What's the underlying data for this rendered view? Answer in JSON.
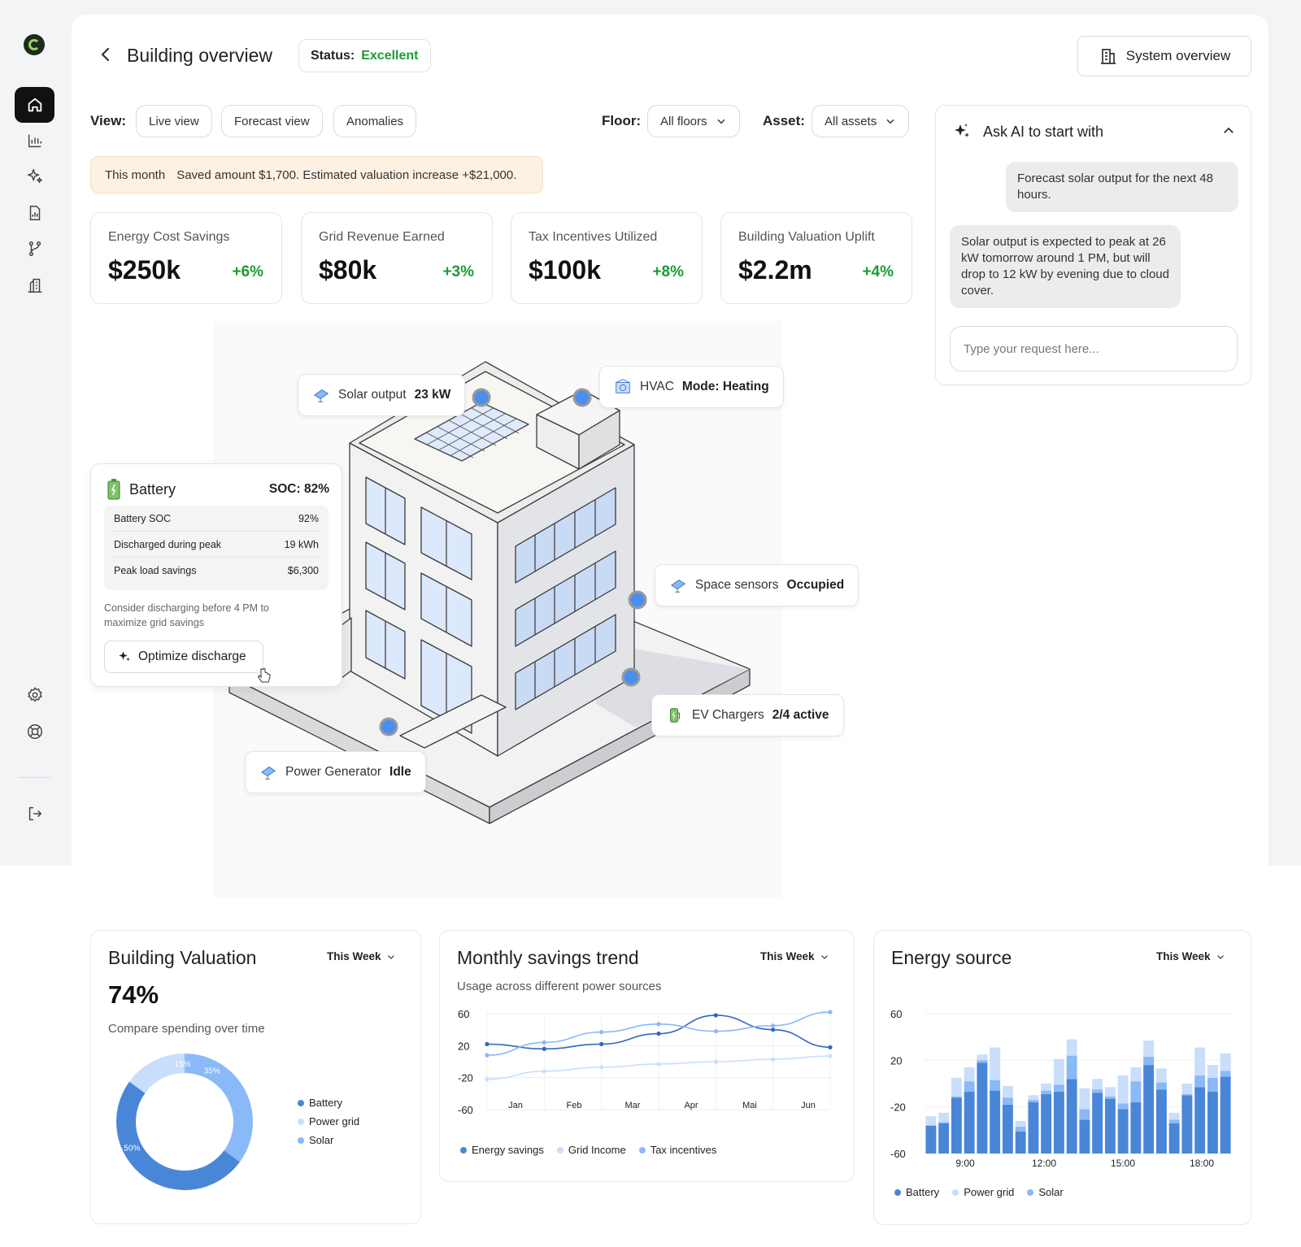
{
  "nav": {
    "items": [
      "home",
      "analytics",
      "ai",
      "reports",
      "flows",
      "buildings"
    ],
    "bottom": [
      "settings",
      "help",
      "logout"
    ]
  },
  "header": {
    "title": "Building overview",
    "status_label": "Status:",
    "status_value": "Excellent",
    "system_button": "System overview"
  },
  "filters": {
    "view_label": "View:",
    "views": [
      "Live view",
      "Forecast view",
      "Anomalies"
    ],
    "floor_label": "Floor:",
    "floor_value": "All floors",
    "asset_label": "Asset:",
    "asset_value": "All assets"
  },
  "notice": {
    "period": "This month",
    "text": "Saved amount $1,700. Estimated valuation increase +$21,000."
  },
  "kpis": [
    {
      "label": "Energy Cost Savings",
      "value": "$250k",
      "change": "+6%"
    },
    {
      "label": "Grid Revenue Earned",
      "value": "$80k",
      "change": "+3%"
    },
    {
      "label": "Tax Incentives Utilized",
      "value": "$100k",
      "change": "+8%"
    },
    {
      "label": "Building Valuation Uplift",
      "value": "$2.2m",
      "change": "+4%"
    }
  ],
  "ai": {
    "title": "Ask AI to start with",
    "user_message": "Forecast solar output for the next 48 hours.",
    "ai_message": "Solar output is expected to peak at 26 kW tomorrow around 1 PM, but will drop to 12 kW by evening due to cloud cover.",
    "input_placeholder": "Type your request here..."
  },
  "tags": {
    "solar": {
      "label": "Solar output",
      "value": "23 kW"
    },
    "hvac": {
      "label": "HVAC",
      "value": "Mode: Heating"
    },
    "space": {
      "label": "Space sensors",
      "value": "Occupied"
    },
    "ev": {
      "label": "EV Chargers",
      "value": "2/4 active"
    },
    "generator": {
      "label": "Power Generator",
      "value": "Idle"
    }
  },
  "battery": {
    "title": "Battery",
    "soc": "SOC: 82%",
    "rows": [
      {
        "label": "Battery SOC",
        "value": "92%"
      },
      {
        "label": "Discharged during peak",
        "value": "19 kWh"
      },
      {
        "label": "Peak load savings",
        "value": "$6,300"
      }
    ],
    "note": "Consider discharging before 4 PM to maximize grid savings",
    "button": "Optimize discharge"
  },
  "colors": {
    "battery": "#4a86d8",
    "power_grid": "#c9defb",
    "solar": "#8ab9f7",
    "positive": "#1a9c35"
  },
  "valuation": {
    "title": "Building Valuation",
    "period": "This Week",
    "value": "74%",
    "subtitle": "Compare spending over time"
  },
  "savings": {
    "title": "Monthly savings trend",
    "period": "This Week",
    "subtitle": "Usage across different power sources"
  },
  "energy": {
    "title": "Energy source",
    "period": "This Week"
  },
  "chart_data": [
    {
      "type": "pie",
      "title": "Building Valuation",
      "categories": [
        "Battery",
        "Power grid",
        "Solar"
      ],
      "values": [
        50,
        15,
        35
      ],
      "labels": [
        "50%",
        "15%",
        "35%"
      ],
      "legend": "right"
    },
    {
      "type": "line",
      "title": "Monthly savings trend",
      "x": [
        "Jan",
        "Feb",
        "Mar",
        "Apr",
        "Mai",
        "Jun"
      ],
      "ylim": [
        -60,
        60
      ],
      "yticks": [
        60,
        20,
        -20,
        -60
      ],
      "series": [
        {
          "name": "Energy savings",
          "values": [
            22,
            16,
            22,
            35,
            58,
            40,
            18
          ]
        },
        {
          "name": "Grid Income",
          "values": [
            -22,
            -12,
            -7,
            -3,
            0,
            3,
            7
          ]
        },
        {
          "name": "Tax incentives",
          "values": [
            8,
            24,
            37,
            47,
            38,
            45,
            62
          ]
        }
      ],
      "legend": "bottom"
    },
    {
      "type": "bar",
      "title": "Energy source",
      "x_ticks": [
        "9:00",
        "12:00",
        "15:00",
        "18:00"
      ],
      "ylim": [
        -60,
        60
      ],
      "yticks": [
        60,
        20,
        -20,
        -60
      ],
      "series": [
        {
          "name": "Battery",
          "values": [
            -36,
            -34,
            -12,
            -7,
            18,
            -6,
            -18,
            -41,
            -16,
            -9,
            -7,
            4,
            -31,
            -8,
            -13,
            -22,
            -16,
            16,
            -5,
            -34,
            -10,
            -3,
            -7,
            6
          ]
        },
        {
          "name": "Power grid",
          "values": [
            8,
            8,
            16,
            12,
            5,
            28,
            10,
            5,
            4,
            6,
            22,
            14,
            18,
            9,
            8,
            24,
            12,
            14,
            12,
            6,
            9,
            24,
            11,
            15
          ]
        },
        {
          "name": "Solar",
          "values": [
            0,
            1,
            1,
            9,
            2,
            9,
            6,
            4,
            2,
            3,
            6,
            20,
            9,
            3,
            2,
            5,
            18,
            7,
            6,
            3,
            1,
            10,
            12,
            5
          ]
        }
      ],
      "legend": "bottom"
    }
  ]
}
